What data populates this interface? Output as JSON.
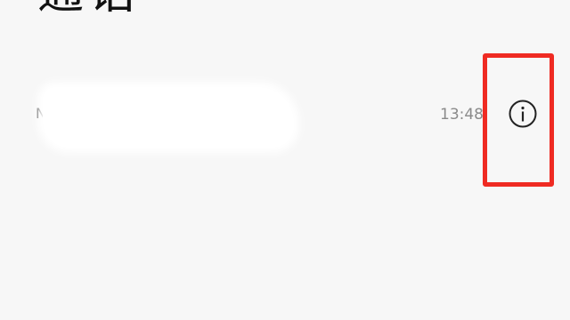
{
  "header": {
    "title": "通话"
  },
  "call_log": {
    "items": [
      {
        "name": "N",
        "time": "13:48",
        "info_icon": "info-icon"
      }
    ]
  },
  "annotation": {
    "highlight_color": "#ef2b23"
  }
}
